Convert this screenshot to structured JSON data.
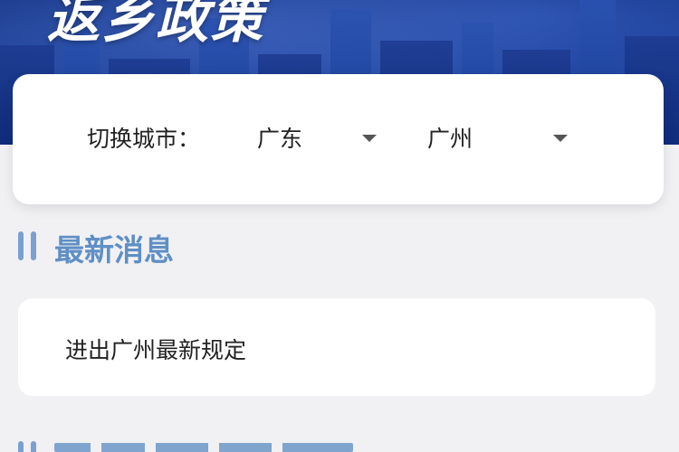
{
  "banner": {
    "title": "返乡政策"
  },
  "city_selector": {
    "label": "切换城市：",
    "province": {
      "selected": "广东"
    },
    "city": {
      "selected": "广州"
    }
  },
  "latest_news": {
    "heading": "最新消息",
    "items": [
      {
        "title": "进出广州最新规定"
      }
    ]
  },
  "colors": {
    "accent": "#5f8fc5",
    "banner": "#1b3f98",
    "card": "#ffffff",
    "background": "#f1f1f3"
  },
  "icons": {
    "dropdown": "caret-down-icon",
    "section_marker": "double-bar-icon"
  }
}
